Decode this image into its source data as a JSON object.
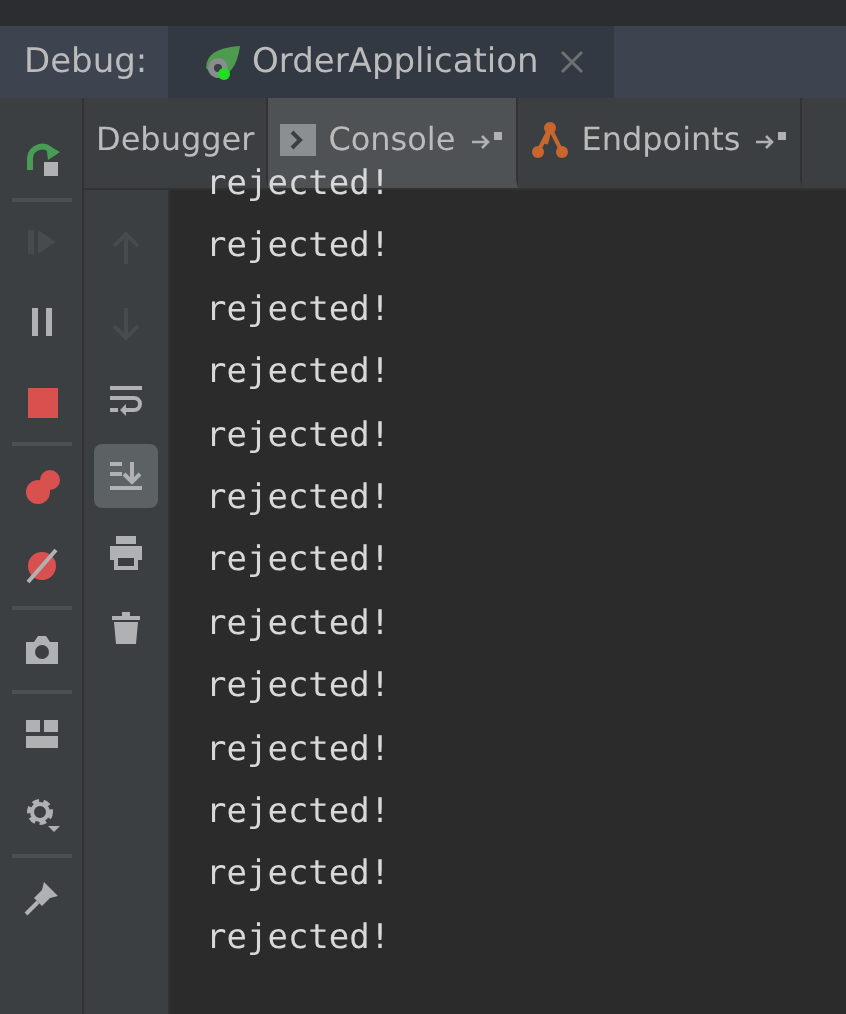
{
  "debug_bar": {
    "label": "Debug:",
    "run_tab": {
      "title": "OrderApplication",
      "selected": true
    }
  },
  "tabs": [
    {
      "label": "Debugger",
      "kind": "plain",
      "selected": false
    },
    {
      "label": "Console",
      "kind": "console",
      "selected": true
    },
    {
      "label": "Endpoints",
      "kind": "endpoints",
      "selected": false
    }
  ],
  "debug_toolbar": [
    {
      "kind": "rerun",
      "disabled": false
    },
    {
      "kind": "resume",
      "disabled": true
    },
    {
      "kind": "pause",
      "disabled": false
    },
    {
      "kind": "stop",
      "disabled": false
    },
    {
      "kind": "breakpoints",
      "disabled": false
    },
    {
      "kind": "mute",
      "disabled": false
    },
    {
      "kind": "camera",
      "disabled": false
    },
    {
      "kind": "layout",
      "disabled": false
    },
    {
      "kind": "settings",
      "disabled": false
    },
    {
      "kind": "pin",
      "disabled": false
    }
  ],
  "console_toolbar": [
    {
      "kind": "up",
      "disabled": true,
      "on": false
    },
    {
      "kind": "down",
      "disabled": true,
      "on": false
    },
    {
      "kind": "wrap",
      "disabled": false,
      "on": false
    },
    {
      "kind": "scroll-end",
      "disabled": false,
      "on": true
    },
    {
      "kind": "print",
      "disabled": false,
      "on": false
    },
    {
      "kind": "clear",
      "disabled": false,
      "on": false
    }
  ],
  "console_lines": [
    "rejected!",
    "rejected!",
    "rejected!",
    "rejected!",
    "rejected!",
    "rejected!",
    "rejected!",
    "rejected!",
    "rejected!",
    "rejected!",
    "rejected!",
    "rejected!",
    "rejected!"
  ]
}
